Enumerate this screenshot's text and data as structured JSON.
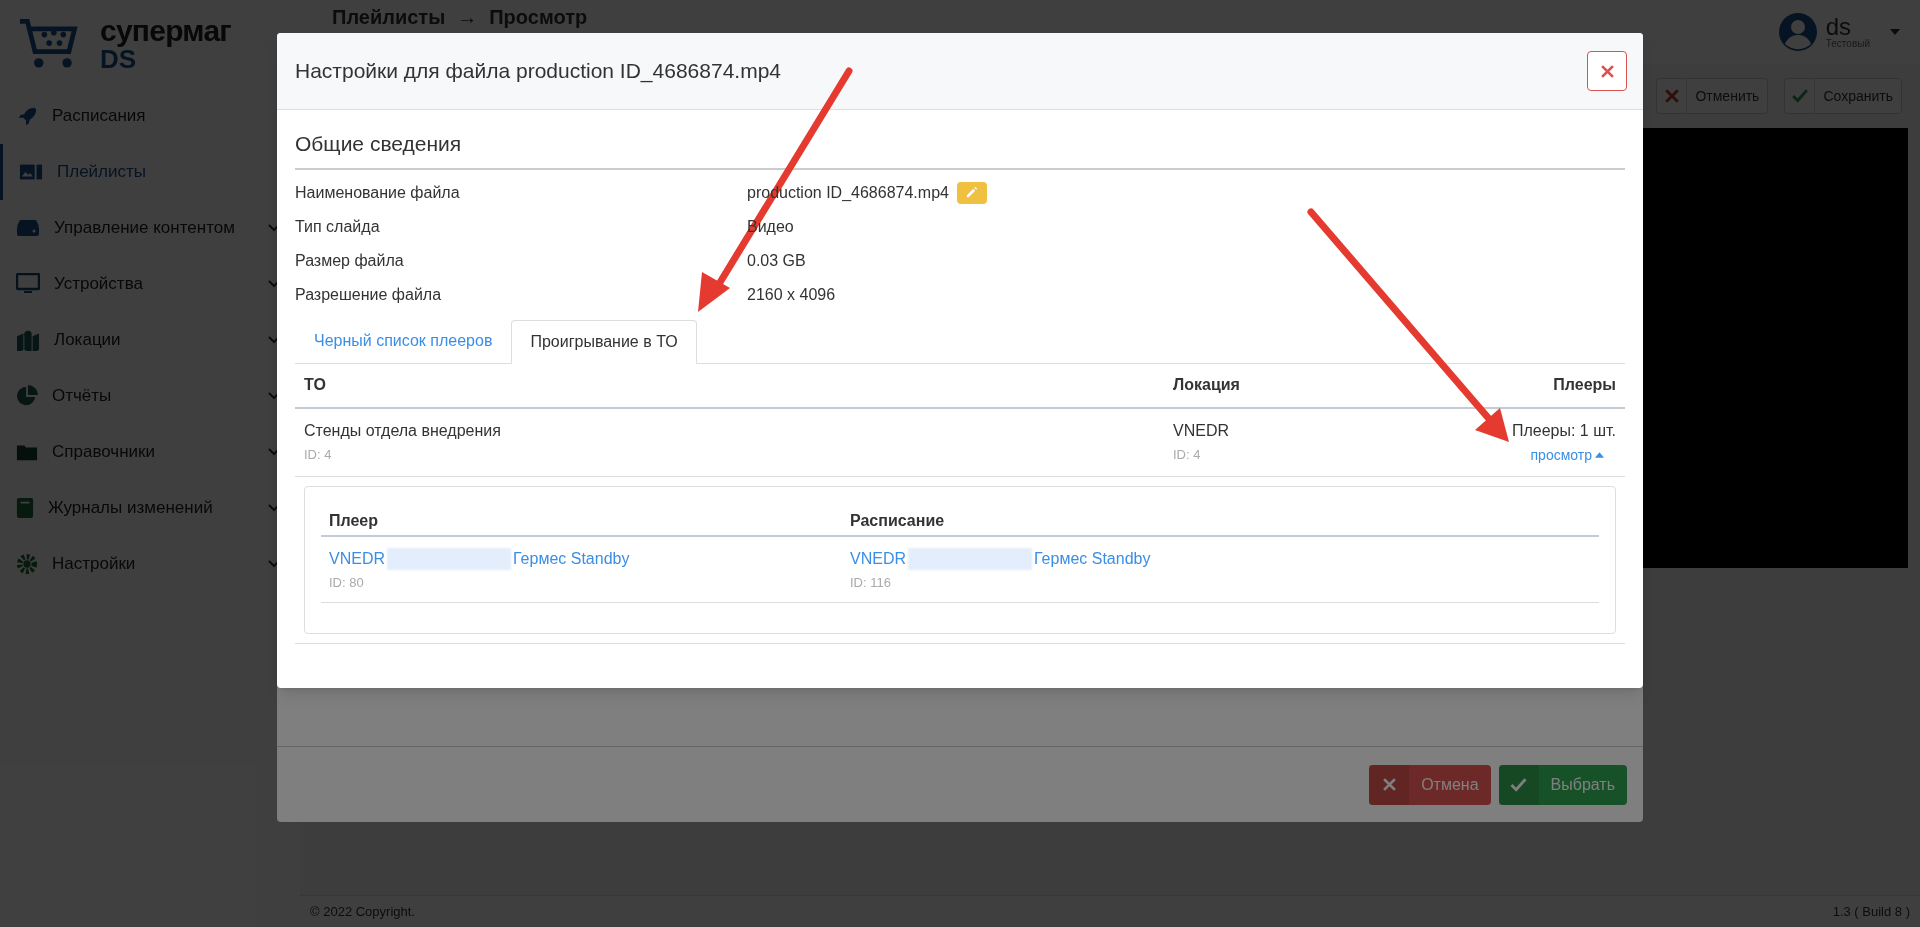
{
  "sidebar": {
    "logo": {
      "title": "супермаг",
      "subtitle": "DS"
    },
    "items": [
      {
        "label": "Расписания",
        "selected": false,
        "expandable": false
      },
      {
        "label": "Плейлисты",
        "selected": true,
        "expandable": false
      },
      {
        "label": "Управление контентом",
        "selected": false,
        "expandable": true
      },
      {
        "label": "Устройства",
        "selected": false,
        "expandable": true
      },
      {
        "label": "Локации",
        "selected": false,
        "expandable": true
      },
      {
        "label": "Отчёты",
        "selected": false,
        "expandable": true
      },
      {
        "label": "Справочники",
        "selected": false,
        "expandable": true
      },
      {
        "label": "Журналы изменений",
        "selected": false,
        "expandable": true
      },
      {
        "label": "Настройки",
        "selected": false,
        "expandable": true
      }
    ]
  },
  "header": {
    "breadcrumb": [
      "Плейлисты",
      "Просмотр"
    ],
    "separator": "→",
    "user": {
      "name": "ds",
      "role": "Тестовый"
    }
  },
  "toolbar": {
    "buttons": [
      {
        "label": "Отменить",
        "kind": "cancel"
      },
      {
        "label": "Сохранить",
        "kind": "save"
      }
    ]
  },
  "background_dialog": {
    "buttons": [
      {
        "label": "Отмена",
        "kind": "cancel"
      },
      {
        "label": "Выбрать",
        "kind": "confirm"
      }
    ]
  },
  "modal": {
    "title": "Настройки для файла production ID_4686874.mp4",
    "section": "Общие сведения",
    "fields": [
      {
        "label": "Наименование файла",
        "value": "production ID_4686874.mp4",
        "editable": true
      },
      {
        "label": "Тип слайда",
        "value": "Видео",
        "editable": false
      },
      {
        "label": "Размер файла",
        "value": "0.03 GB",
        "editable": false
      },
      {
        "label": "Разрешение файла",
        "value": "2160 x 4096",
        "editable": false
      }
    ],
    "tabs": [
      {
        "label": "Черный список плееров",
        "selected": false
      },
      {
        "label": "Проигрывание в ТО",
        "selected": true
      }
    ],
    "table": {
      "columns": [
        "ТО",
        "Локация",
        "Плееры"
      ],
      "rows": [
        {
          "store": {
            "name": "Стенды отдела внедрения",
            "id": "ID: 4"
          },
          "location": {
            "name": "VNEDR",
            "id": "ID: 4"
          },
          "players": {
            "count": "Плееры: 1 шт.",
            "toggle": "просмотр",
            "expanded": true
          },
          "details": {
            "columns": [
              "Плеер",
              "Расписание"
            ],
            "rows": [
              {
                "player": {
                  "name_start": "VNEDR",
                  "name_end": "Гермес Standby",
                  "id": "ID: 80"
                },
                "schedule": {
                  "name_start": "VNEDR",
                  "name_end": "Гермес Standby",
                  "id": "ID: 116"
                }
              }
            ]
          }
        }
      ]
    }
  },
  "footer": {
    "copyright": "© 2022 Copyright.",
    "version": "1.3 ( Build 8 )"
  }
}
